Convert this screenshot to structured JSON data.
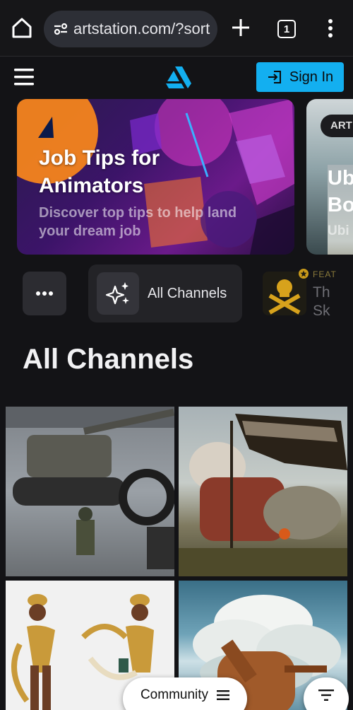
{
  "browser": {
    "url": "artstation.com/?sort",
    "tab_count": "1",
    "icons": [
      "home-icon",
      "site-settings-icon",
      "new-tab-icon",
      "tab-switcher-icon",
      "more-vert-icon"
    ]
  },
  "header": {
    "logo": "artstation-logo",
    "sign_in_label": "Sign In",
    "accent_color": "#13aff0"
  },
  "banners": [
    {
      "title": "Job Tips for Animators",
      "subtitle": "Discover top tips to help land your dream job"
    },
    {
      "tag": "ART",
      "title_partial": "Ub\nBo",
      "subtitle_partial": "Ubi"
    }
  ],
  "channels": {
    "more_icon": "more-horiz-icon",
    "all_label": "All Channels",
    "featured_label": "FEAT",
    "featured_name": "Th\nSk"
  },
  "section_title": "All Channels",
  "gallery": [
    {
      "name": "sci-fi tank walker artwork"
    },
    {
      "name": "armored knight on beast artwork"
    },
    {
      "name": "character design sheet artwork"
    },
    {
      "name": "clouds and rusty tower artwork"
    }
  ],
  "controls": {
    "community_label": "Community",
    "filter_icon": "filter-icon"
  }
}
